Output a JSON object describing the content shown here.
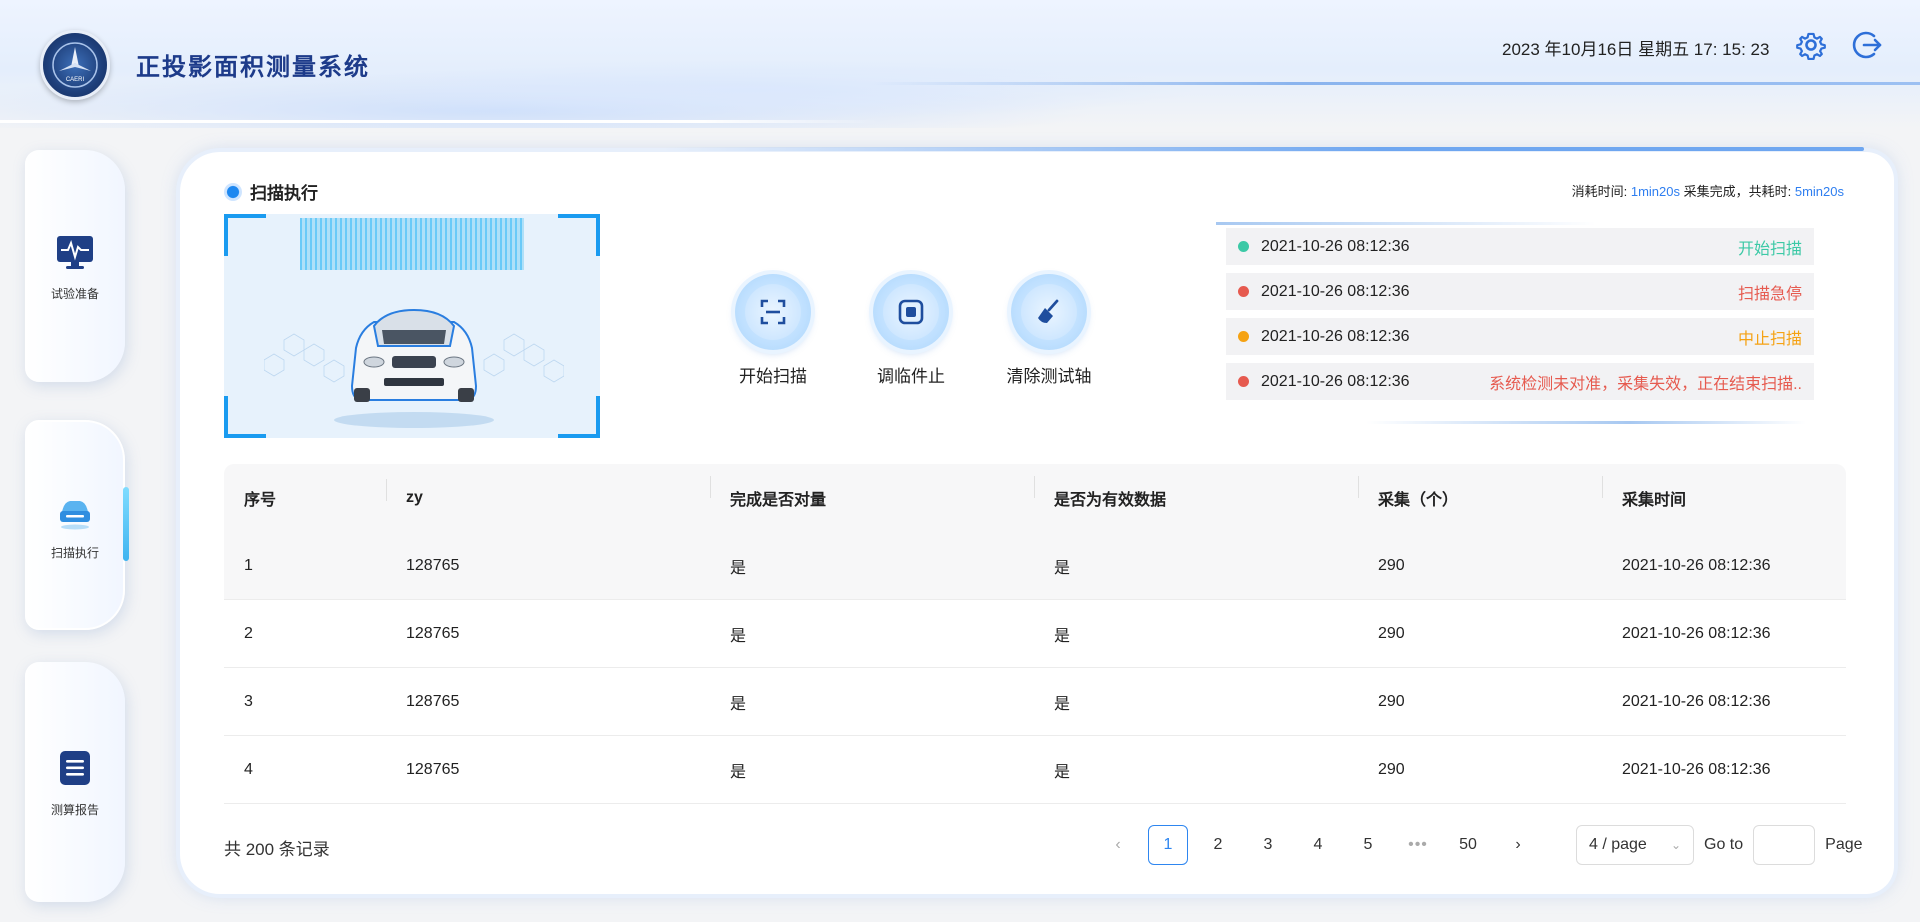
{
  "header": {
    "title": "正投影面积测量系统",
    "datetime": "2023 年10月16日 星期五 17: 15: 23",
    "logo_text": "CAERI"
  },
  "sidebar": {
    "items": [
      {
        "label": "试验准备",
        "icon": "monitor-pulse-icon"
      },
      {
        "label": "扫描执行",
        "icon": "scanner-car-icon",
        "active": true
      },
      {
        "label": "测算报告",
        "icon": "report-list-icon"
      }
    ]
  },
  "main": {
    "section_title": "扫描执行",
    "stats": {
      "elapsed_label": "消耗时间:",
      "elapsed_value": "1min20s",
      "done_label": "采集完成，共耗时:",
      "total_value": "5min20s"
    },
    "actions": [
      {
        "label": "开始扫描",
        "icon": "scan-frame-icon"
      },
      {
        "label": "调临件止",
        "icon": "stop-square-icon"
      },
      {
        "label": "清除测试轴",
        "icon": "broom-icon"
      }
    ],
    "logs": [
      {
        "time": "2021-10-26 08:12:36",
        "message": "开始扫描",
        "color": "#3cc9a6"
      },
      {
        "time": "2021-10-26 08:12:36",
        "message": "扫描急停",
        "color": "#e65a4f"
      },
      {
        "time": "2021-10-26 08:12:36",
        "message": "中止扫描",
        "color": "#f5a213"
      },
      {
        "time": "2021-10-26 08:12:36",
        "message": "系统检测未对准，采集失效，正在结束扫描..",
        "color": "#e65a4f"
      }
    ]
  },
  "table": {
    "columns": [
      "序号",
      "zy",
      "完成是否对量",
      "是否为有效数据",
      "采集（个）",
      "采集时间"
    ],
    "rows": [
      [
        "1",
        "128765",
        "是",
        "是",
        "290",
        "2021-10-26 08:12:36"
      ],
      [
        "2",
        "128765",
        "是",
        "是",
        "290",
        "2021-10-26 08:12:36"
      ],
      [
        "3",
        "128765",
        "是",
        "是",
        "290",
        "2021-10-26 08:12:36"
      ],
      [
        "4",
        "128765",
        "是",
        "是",
        "290",
        "2021-10-26 08:12:36"
      ]
    ]
  },
  "pagination": {
    "total_text": "共 200 条记录",
    "pages": [
      "1",
      "2",
      "3",
      "4",
      "5"
    ],
    "ellipsis": "•••",
    "last_page": "50",
    "current": "1",
    "page_size": "4 / page",
    "goto_label": "Go to",
    "page_label": "Page",
    "goto_value": ""
  },
  "colors": {
    "accent": "#2e86f0",
    "brand_title": "#1d3b8a"
  }
}
